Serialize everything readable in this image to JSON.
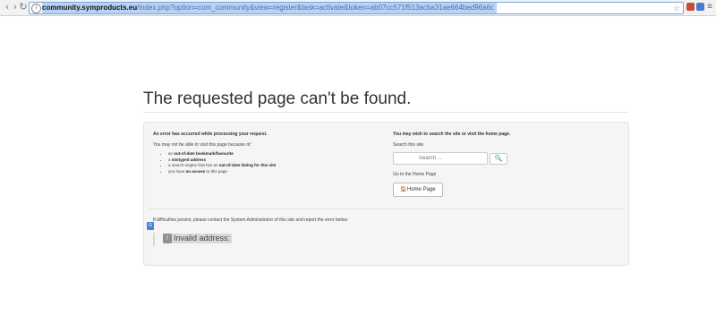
{
  "browser": {
    "url_host": "community.symproducts.eu",
    "url_path": "/index.php?option=com_community&view=register&task=activate&token=ab07cc571f513acba31ae664bed96a6c",
    "info_icon": "info-icon",
    "star_icon": "bookmark-star-icon",
    "menu_icon": "menu-icon"
  },
  "page": {
    "title": "The requested page can't be found."
  },
  "error_panel": {
    "left": {
      "heading": "An error has occurred while processing your request.",
      "intro": "You may not be able to visit this page because of:",
      "reasons": [
        {
          "pre": "an ",
          "bold": "out-of-date bookmark/favourite",
          "post": ""
        },
        {
          "pre": "a ",
          "bold": "mistyped address",
          "post": ""
        },
        {
          "pre": "a search engine that has an ",
          "bold": "out-of-date listing for this site",
          "post": ""
        },
        {
          "pre": "you have ",
          "bold": "no access",
          "post": " to this page"
        }
      ]
    },
    "right": {
      "heading": "You may wish to search the site or visit the home page.",
      "search_label": "Search this site",
      "search_placeholder": "Search ...",
      "search_button_icon": "search-icon",
      "search_button_glyph": "🔍",
      "goto_label": "Go to the Home Page",
      "home_button_label": "Home Page",
      "home_icon_glyph": "🏠"
    },
    "persist_text": "If difficulties persist, please contact the System Administrator of this site and report the error below.",
    "error_message": "Invalid address:",
    "error_icon_glyph": "!"
  }
}
